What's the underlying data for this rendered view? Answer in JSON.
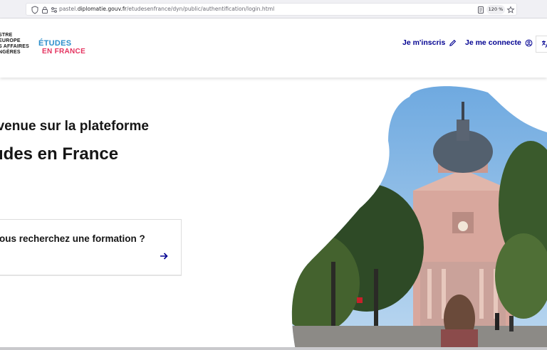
{
  "browser": {
    "url_prefix": "pastel.",
    "url_domain": "diplomatie.gouv.fr",
    "url_path": "/etudesenfrance/dyn/public/authentification/login.html",
    "zoom": "120 %",
    "icons": [
      "shield-icon",
      "lock-icon",
      "permissions-icon",
      "reader-view-icon",
      "bookmark-star-icon"
    ]
  },
  "header": {
    "gov_logo_lines": [
      "STRE",
      "EUROPE",
      "S AFFAIRES",
      "NGÈRES"
    ],
    "brand_line1": "ÉTUDES",
    "brand_line2": "EN FRANCE",
    "signup_label": "Je m'inscris",
    "login_label": "Je me connecte",
    "icons": [
      "pencil-icon",
      "user-circle-icon",
      "translate-icon"
    ]
  },
  "main": {
    "welcome": "nvenue sur la plateforme",
    "title": "udes en France",
    "card_label": "ous recherchez une formation ?",
    "icons": [
      "arrow-right-icon"
    ]
  },
  "colors": {
    "primary_blue": "#000091",
    "brand_blue": "#2b8ecb",
    "brand_red": "#e4325f",
    "text": "#161616"
  },
  "image": {
    "subject": "sorbonne-chapel-photo"
  }
}
